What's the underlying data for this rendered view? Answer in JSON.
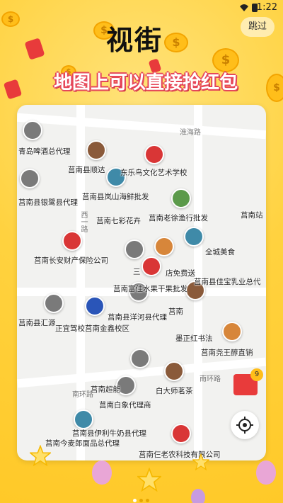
{
  "status_bar": {
    "time": "1:22"
  },
  "skip_label": "跳过",
  "logo_text": "视街",
  "headline": "地图上可以直接抢红包",
  "map": {
    "road_labels": [
      "淮海路",
      "南环路",
      "西一路",
      "南环路"
    ],
    "pois": [
      "青岛啤酒总代理",
      "莒南县顺达",
      "东乐鸟文化艺术学校",
      "莒南县银鹭县代理",
      "莒南县岚山海鲜批发",
      "莒南七彩花卉",
      "莒南老徐渔行批发",
      "莒南站",
      "莒南长安财产保险公司",
      "全城美食",
      "三",
      "店免费送",
      "莒南县佳宝乳业总代",
      "莒南富佳水果干果批发",
      "莒南县洋河县代理",
      "莒南",
      "正宜驾校莒南金鑫校区",
      "莒南县汇源",
      "墨正红书法",
      "莒南尧王醇直销",
      "莒南超能",
      "白大师茗茶",
      "莒南白象代理商",
      "莒南县伊利牛奶县代理",
      "莒南今麦郎面品总代理",
      "莒南仨老农科技有限公司"
    ]
  },
  "redpack_count": "9",
  "pager": {
    "active_index": 0,
    "count": 3
  }
}
